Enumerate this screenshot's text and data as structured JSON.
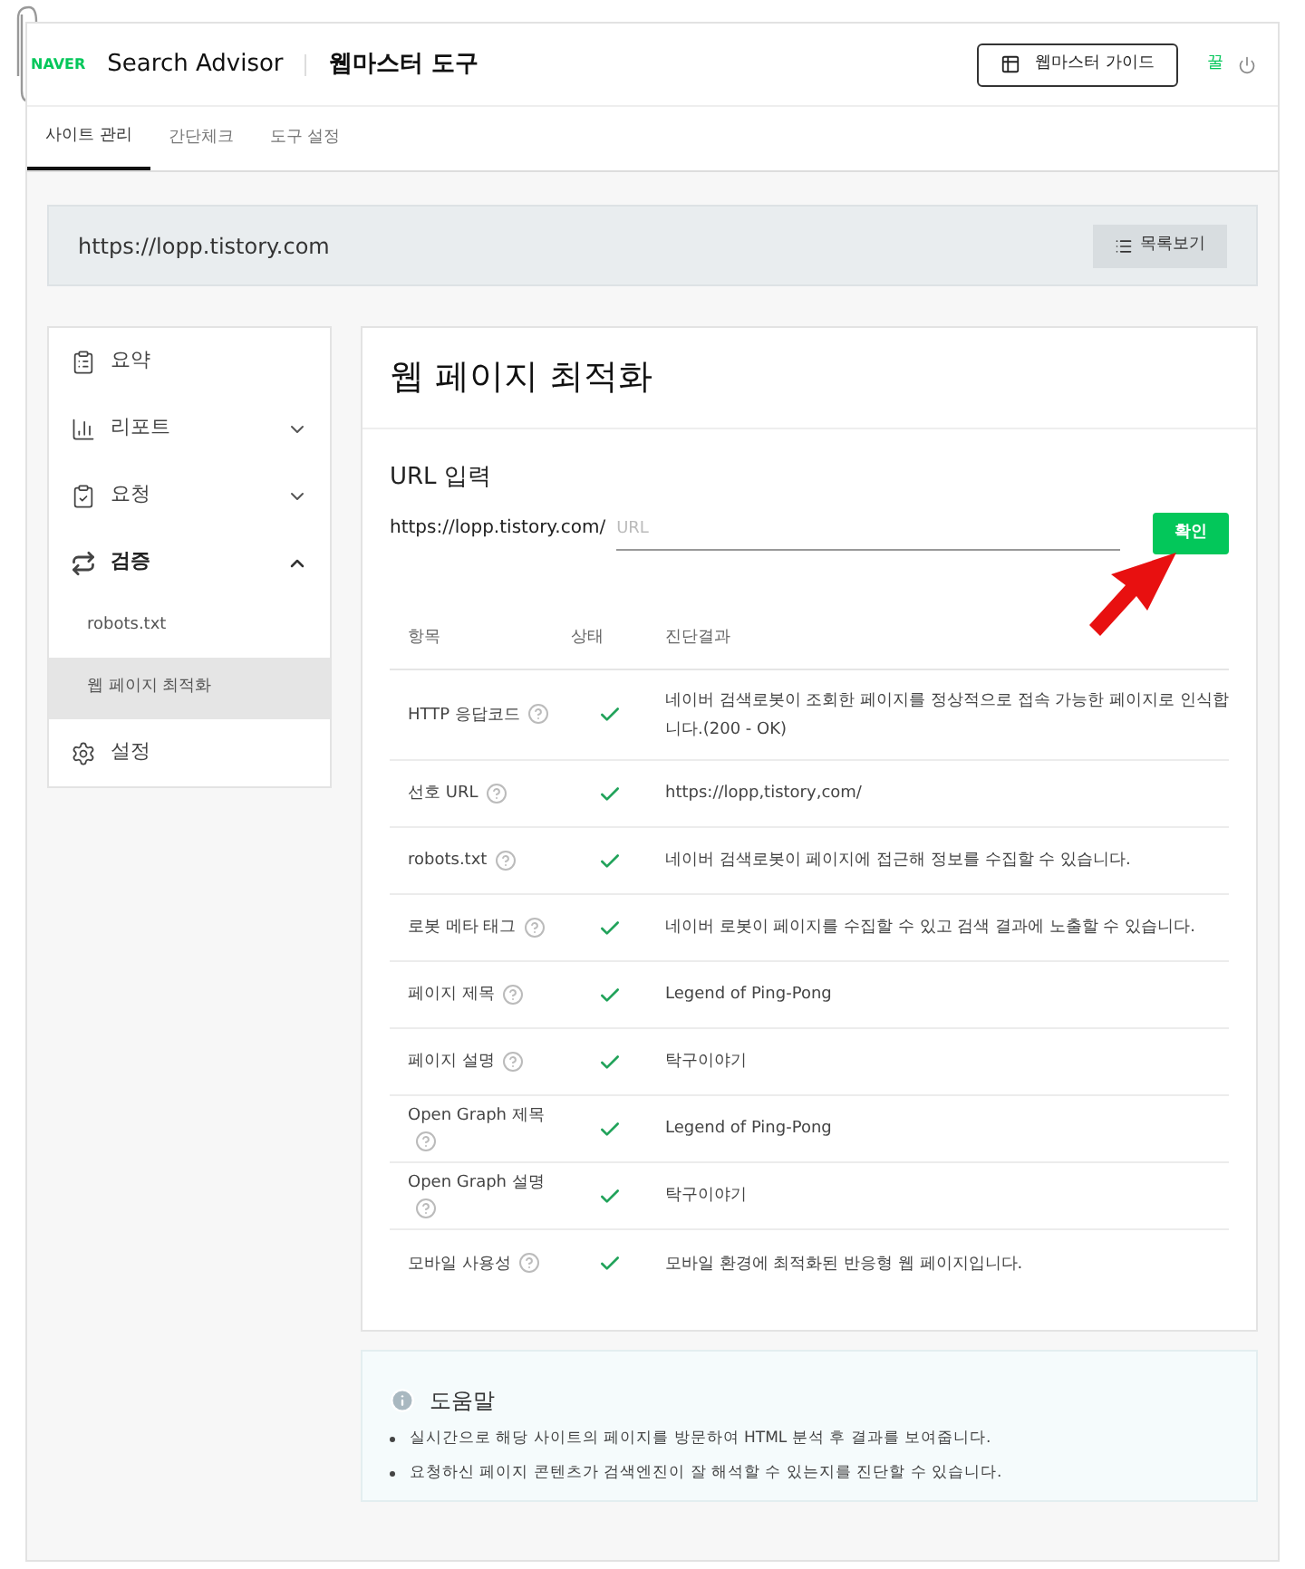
{
  "header": {
    "logo": "NAVER",
    "product": "Search Advisor",
    "tool": "웹마스터 도구",
    "guide_button": "웹마스터 가이드",
    "user": "꿀"
  },
  "tabs": [
    {
      "label": "사이트 관리",
      "selected": true
    },
    {
      "label": "간단체크",
      "selected": false
    },
    {
      "label": "도구 설정",
      "selected": false
    }
  ],
  "site_bar": {
    "url": "https://lopp.tistory.com",
    "list_button": "목록보기"
  },
  "sidebar": {
    "items": [
      {
        "label": "요약",
        "kind": "summary",
        "selected": false
      },
      {
        "label": "리포트",
        "kind": "report",
        "expanded": false,
        "selected": false
      },
      {
        "label": "요청",
        "kind": "request",
        "expanded": false,
        "selected": false
      },
      {
        "label": "검증",
        "kind": "verify",
        "expanded": true,
        "selected": false,
        "children": [
          {
            "label": "robots.txt",
            "selected": false
          },
          {
            "label": "웹 페이지 최적화",
            "selected": true
          }
        ]
      },
      {
        "label": "설정",
        "kind": "settings",
        "selected": false
      }
    ]
  },
  "main": {
    "title": "웹 페이지 최적화",
    "url_label": "URL 입력",
    "url_prefix": "https://lopp.tistory.com/",
    "url_placeholder": "URL",
    "confirm_button": "확인",
    "table": {
      "columns": [
        "항목",
        "상태",
        "진단결과"
      ],
      "rows": [
        {
          "item": "HTTP 응답코드",
          "ok": true,
          "result": "네이버 검색로봇이 조회한 페이지를 정상적으로 접속 가능한 페이지로 인식합니다.(200 - OK)"
        },
        {
          "item": "선호 URL",
          "ok": true,
          "result": "https://lopp,tistory,com/"
        },
        {
          "item": "robots.txt",
          "ok": true,
          "result": "네이버 검색로봇이 페이지에 접근해 정보를 수집할 수 있습니다."
        },
        {
          "item": "로봇 메타 태그",
          "ok": true,
          "result": "네이버 로봇이 페이지를 수집할 수 있고 검색 결과에 노출할 수 있습니다."
        },
        {
          "item": "페이지 제목",
          "ok": true,
          "result": "Legend of Ping-Pong"
        },
        {
          "item": "페이지 설명",
          "ok": true,
          "result": "탁구이야기"
        },
        {
          "item": "Open Graph 제목",
          "ok": true,
          "result": "Legend of Ping-Pong"
        },
        {
          "item": "Open Graph 설명",
          "ok": true,
          "result": "탁구이야기"
        },
        {
          "item": "모바일 사용성",
          "ok": true,
          "result": "모바일 환경에 최적화된 반응형 웹 페이지입니다."
        }
      ]
    }
  },
  "help": {
    "title": "도움말",
    "bullets": [
      "실시간으로 해당 사이트의 페이지를 방문하여 HTML 분석 후 결과를 보여줍니다.",
      "요청하신 페이지 콘텐츠가 검색엔진이 잘 해석할 수 있는지를 진단할 수 있습니다."
    ]
  }
}
